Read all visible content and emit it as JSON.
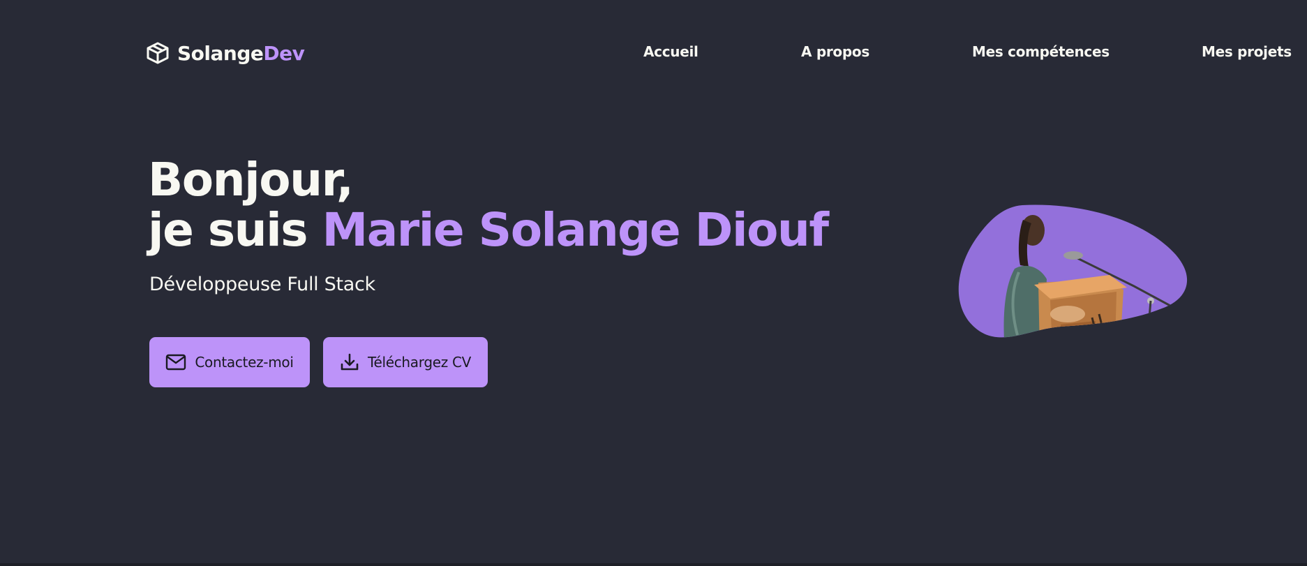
{
  "header": {
    "logo": {
      "icon": "cube-icon",
      "text_main": "Solange",
      "text_accent": "Dev"
    },
    "nav": [
      {
        "label": "Accueil"
      },
      {
        "label": "A propos"
      },
      {
        "label": "Mes compétences"
      },
      {
        "label": "Mes projets"
      }
    ]
  },
  "hero": {
    "greeting": "Bonjour,",
    "intro": "je suis ",
    "name": "Marie Solange Diouf",
    "subtitle": "Développeuse Full Stack",
    "buttons": {
      "contact": {
        "label": "Contactez-moi",
        "icon": "mail-icon"
      },
      "cv": {
        "label": "Téléchargez CV",
        "icon": "download-icon"
      }
    },
    "portrait": {
      "icon": "portrait-photo"
    }
  },
  "colors": {
    "background": "#282a36",
    "accent": "#bd93f9",
    "blob": "#9370db",
    "text": "#f8f8f2"
  }
}
